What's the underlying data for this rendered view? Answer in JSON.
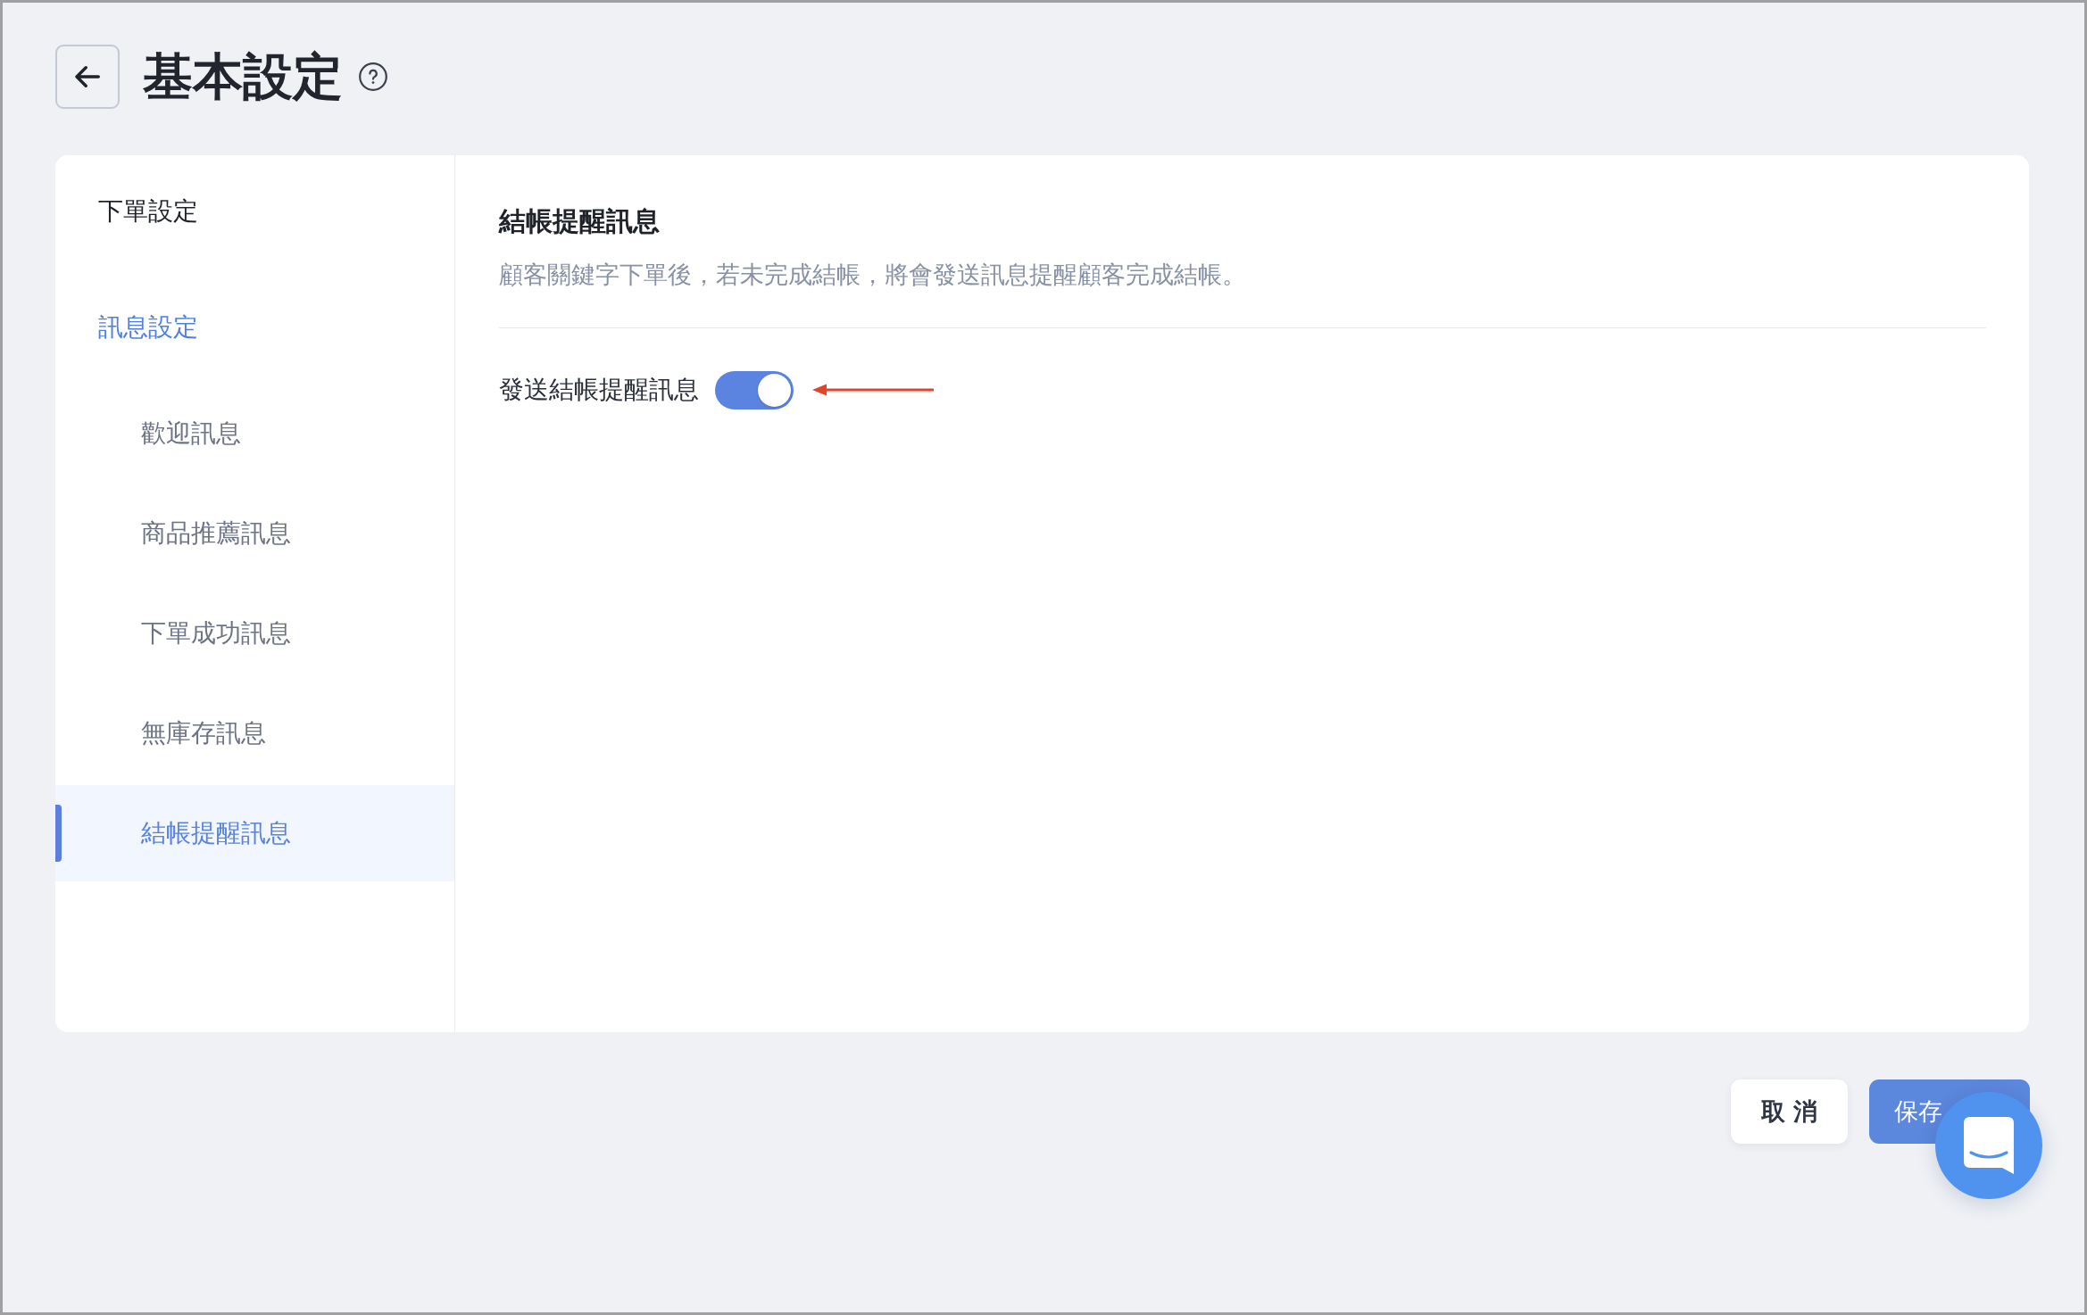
{
  "header": {
    "title": "基本設定"
  },
  "sidebar": {
    "items": [
      {
        "label": "下單設定",
        "active": false
      },
      {
        "label": "訊息設定",
        "active": true,
        "children": [
          {
            "label": "歡迎訊息",
            "selected": false
          },
          {
            "label": "商品推薦訊息",
            "selected": false
          },
          {
            "label": "下單成功訊息",
            "selected": false
          },
          {
            "label": "無庫存訊息",
            "selected": false
          },
          {
            "label": "結帳提醒訊息",
            "selected": true
          }
        ]
      }
    ]
  },
  "panel": {
    "title": "結帳提醒訊息",
    "description": "顧客關鍵字下單後，若未完成結帳，將會發送訊息提醒顧客完成結帳。",
    "settings": [
      {
        "kind": "toggle",
        "label": "發送結帳提醒訊息",
        "on": true
      }
    ]
  },
  "footer": {
    "buttons": [
      {
        "kind": "secondary",
        "label": "取 消"
      },
      {
        "kind": "primary",
        "label": "保存"
      }
    ]
  }
}
